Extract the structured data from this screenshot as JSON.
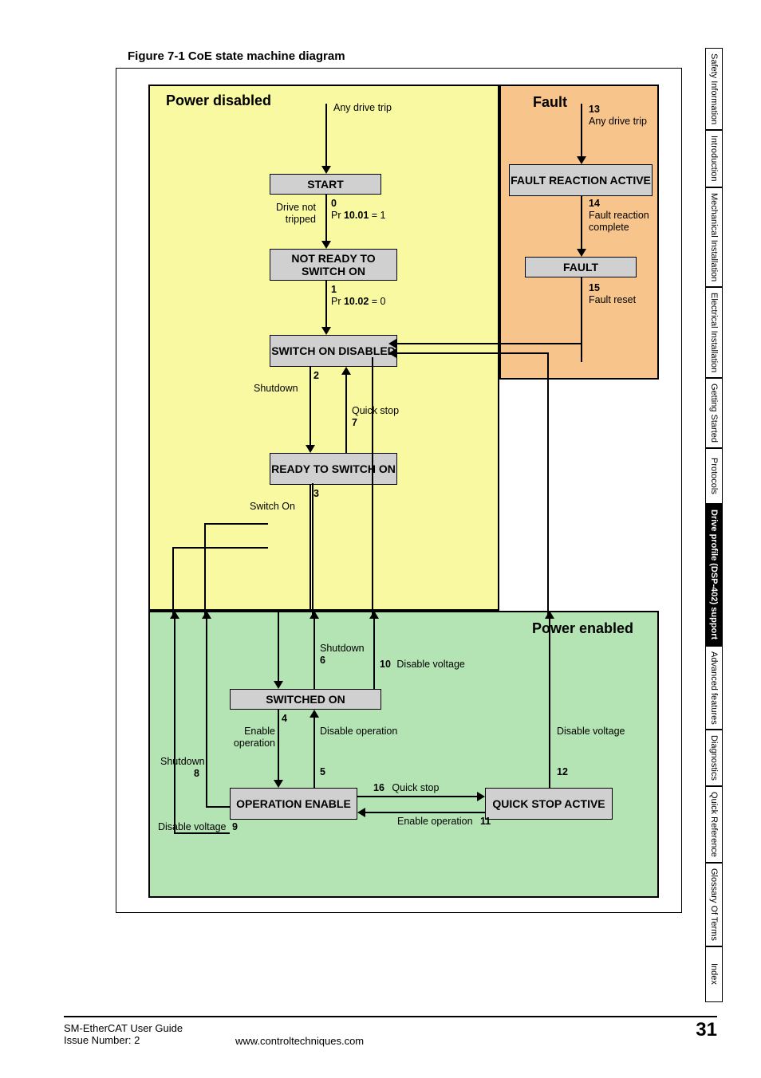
{
  "figure_caption": "Figure 7-1  CoE state machine diagram",
  "chart_data": {
    "type": "state_machine",
    "title": "CoE state machine diagram",
    "regions": [
      {
        "id": "power_disabled",
        "label": "Power disabled",
        "color": "#F9F9A1"
      },
      {
        "id": "fault_region",
        "label": "Fault",
        "color": "#F7C48B"
      },
      {
        "id": "power_enabled",
        "label": "Power enabled",
        "color": "#B4E4B4"
      }
    ],
    "states": [
      {
        "id": "start",
        "label": "START",
        "region": "power_disabled"
      },
      {
        "id": "not_ready_to_switch_on",
        "label": "NOT READY TO\nSWITCH ON",
        "region": "power_disabled"
      },
      {
        "id": "switch_on_disabled",
        "label": "SWITCH ON\nDISABLED",
        "region": "power_disabled"
      },
      {
        "id": "ready_to_switch_on",
        "label": "READY TO\nSWITCH ON",
        "region": "power_disabled"
      },
      {
        "id": "fault_reaction_active",
        "label": "FAULT REACTION\nACTIVE",
        "region": "fault_region"
      },
      {
        "id": "fault",
        "label": "FAULT",
        "region": "fault_region"
      },
      {
        "id": "switched_on",
        "label": "SWITCHED ON",
        "region": "power_enabled"
      },
      {
        "id": "operation_enable",
        "label": "OPERATION\nENABLE",
        "region": "power_enabled"
      },
      {
        "id": "quick_stop_active",
        "label": "QUICK STOP\nACTIVE",
        "region": "power_enabled"
      }
    ],
    "transitions": [
      {
        "n": 0,
        "from": "start",
        "to": "not_ready_to_switch_on",
        "label": "Drive not tripped",
        "cond": "Pr 10.01 = 1"
      },
      {
        "n": 1,
        "from": "not_ready_to_switch_on",
        "to": "switch_on_disabled",
        "cond": "Pr 10.02 = 0"
      },
      {
        "n": 2,
        "from": "switch_on_disabled",
        "to": "ready_to_switch_on",
        "label": "Shutdown"
      },
      {
        "n": 3,
        "from": "ready_to_switch_on",
        "to": "switched_on",
        "label": "Switch On"
      },
      {
        "n": 4,
        "from": "switched_on",
        "to": "operation_enable",
        "label": "Enable operation"
      },
      {
        "n": 5,
        "from": "operation_enable",
        "to": "switched_on",
        "label": "Disable operation"
      },
      {
        "n": 6,
        "from": "switched_on",
        "to": "ready_to_switch_on",
        "label": "Shutdown"
      },
      {
        "n": 7,
        "from": "ready_to_switch_on",
        "to": "switch_on_disabled",
        "label": "Quick stop"
      },
      {
        "n": 8,
        "from": "operation_enable",
        "to": "ready_to_switch_on",
        "label": "Shutdown"
      },
      {
        "n": 9,
        "from": "operation_enable",
        "to": "switch_on_disabled",
        "label": "Disable voltage"
      },
      {
        "n": 10,
        "from": "switched_on",
        "to": "switch_on_disabled",
        "label": "Disable voltage"
      },
      {
        "n": 11,
        "from": "quick_stop_active",
        "to": "operation_enable",
        "label": "Enable operation"
      },
      {
        "n": 12,
        "from": "quick_stop_active",
        "to": "switch_on_disabled",
        "label": "Disable voltage"
      },
      {
        "n": 13,
        "from": "any",
        "to": "fault_reaction_active",
        "label": "Any drive trip"
      },
      {
        "n": 14,
        "from": "fault_reaction_active",
        "to": "fault",
        "label": "Fault reaction complete"
      },
      {
        "n": 15,
        "from": "fault",
        "to": "switch_on_disabled",
        "label": "Fault reset"
      },
      {
        "n": 16,
        "from": "operation_enable",
        "to": "quick_stop_active",
        "label": "Quick stop"
      }
    ],
    "notes": {
      "entry_power_disabled": "Any drive trip"
    }
  },
  "regions": {
    "power_disabled": "Power disabled",
    "fault": "Fault",
    "power_enabled": "Power enabled"
  },
  "states": {
    "start": "START",
    "not_ready": "NOT READY TO SWITCH ON",
    "switch_on_disabled": "SWITCH ON DISABLED",
    "ready_to_switch_on": "READY TO SWITCH ON",
    "fault_reaction_active": "FAULT REACTION ACTIVE",
    "fault": "FAULT",
    "switched_on": "SWITCHED ON",
    "operation_enable": "OPERATION ENABLE",
    "quick_stop_active": "QUICK STOP ACTIVE"
  },
  "t": {
    "entry_pd": "Any drive trip",
    "0_left": "Drive not tripped",
    "0_num": "0",
    "0_right": "Pr 10.01 = 1",
    "1_num": "1",
    "1_right": "Pr 10.02 = 0",
    "2_num": "2",
    "2_left": "Shutdown",
    "7_num": "7",
    "7_right": "Quick stop",
    "3_num": "3",
    "3_left": "Switch On",
    "6_num": "6",
    "6_right": "Shutdown",
    "10_num": "10",
    "10_right": "Disable voltage",
    "4_num": "4",
    "4_left": "Enable operation",
    "5_num": "5",
    "5_right": "Disable operation",
    "12_num": "12",
    "12_right": "Disable voltage",
    "8_num": "8",
    "8_left": "Shutdown",
    "9_num": "9",
    "9_left": "Disable voltage",
    "11_num": "11",
    "11_right": "Enable operation",
    "16_num": "16",
    "16_right": "Quick stop",
    "13_num": "13",
    "13_right": "Any drive trip",
    "14_num": "14",
    "14_right": "Fault reaction complete",
    "15_num": "15",
    "15_right": "Fault reset"
  },
  "sidebar": {
    "items": [
      "Safety Information",
      "Introduction",
      "Mechanical Installation",
      "Electrical Installation",
      "Getting Started",
      "Protocols",
      "Drive profile (DSP-402) support",
      "Advanced features",
      "Diagnostics",
      "Quick Reference",
      "Glossary Of Terms",
      "Index"
    ],
    "active_index": 6
  },
  "footer": {
    "doc_title": "SM-EtherCAT User Guide",
    "issue": "Issue Number:  2",
    "url": "www.controltechniques.com",
    "page": "31"
  }
}
